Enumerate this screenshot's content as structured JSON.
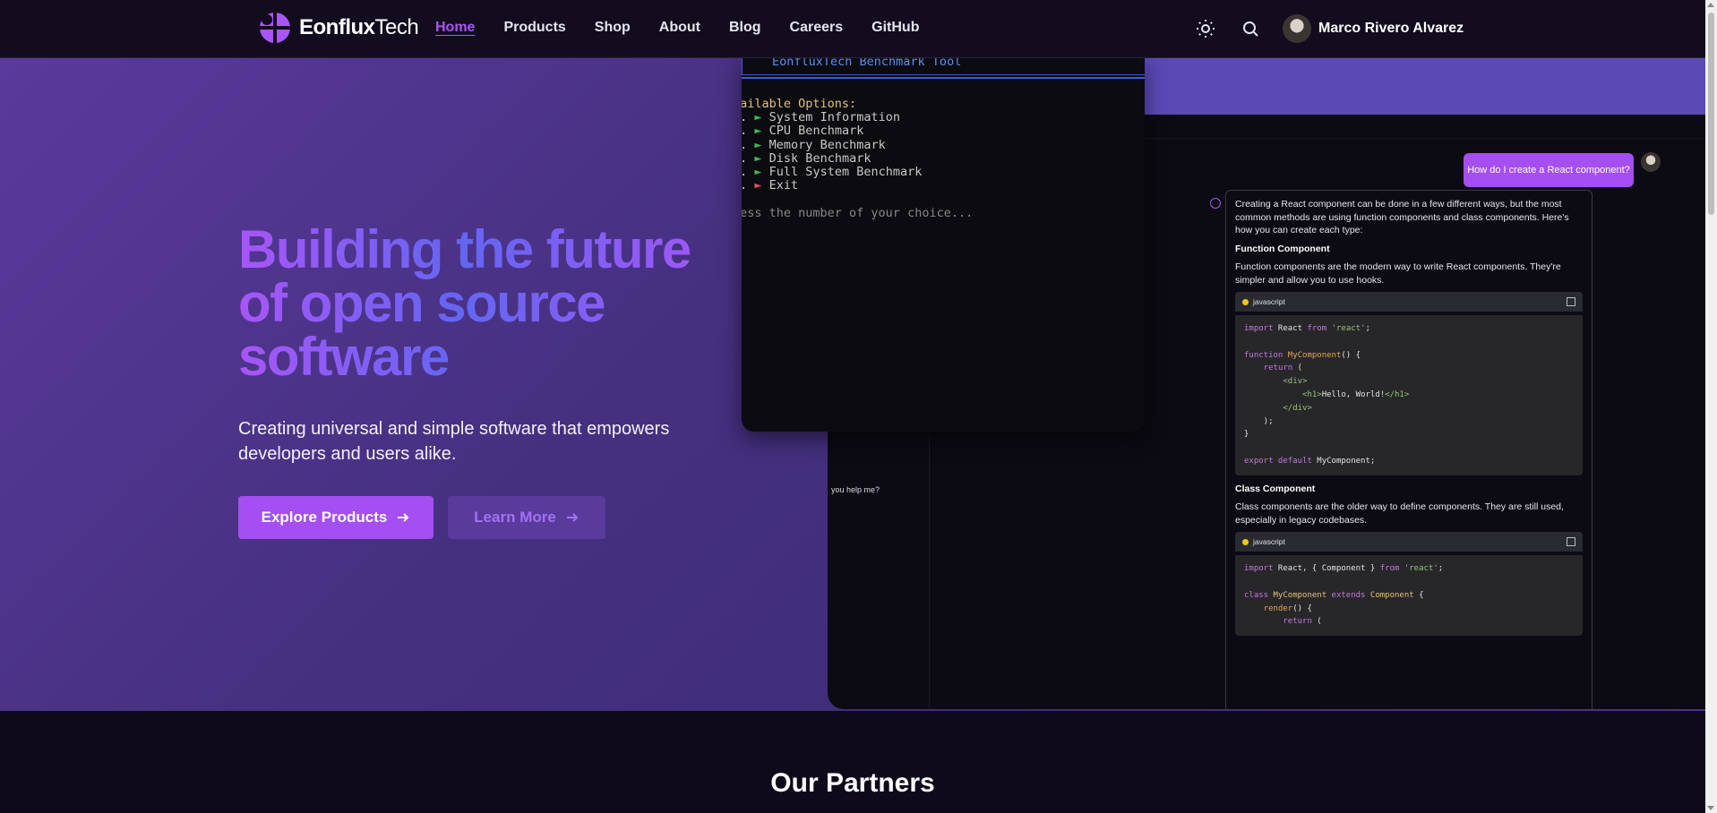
{
  "nav": {
    "brand_bold": "Eonflux",
    "brand_light": "Tech",
    "links": [
      "Home",
      "Products",
      "Shop",
      "About",
      "Blog",
      "Careers",
      "GitHub"
    ],
    "active_link": "Home",
    "user_name": "Marco Rivero Alvarez",
    "icons": [
      "theme-toggle-icon",
      "search-icon"
    ]
  },
  "hero": {
    "title": "Building the future of open source software",
    "subtitle": "Creating universal and simple software that empowers developers and users alike.",
    "primary_button": "Explore Products",
    "secondary_button": "Learn More"
  },
  "terminal": {
    "title": "EonfluxTech Benchmark Tool",
    "options_header": "vailable Options:",
    "options": [
      "System Information",
      "CPU Benchmark",
      "Memory Benchmark",
      "Disk Benchmark",
      "Full System Benchmark",
      "Exit"
    ],
    "prompt": "ress the number of your choice..."
  },
  "chat": {
    "user_message": "How do I create a React component?",
    "fragment_text": "you help me?",
    "intro": "Creating a React component can be done in a few different ways, but the most common methods are using function components and class components. Here's how you can create each type:",
    "function_heading": "Function Component",
    "function_desc": "Function components are the modern way to write React components. They're simpler and allow you to use hooks.",
    "class_heading": "Class Component",
    "class_desc": "Class components are the older way to define components. They are still used, especially in legacy codebases.",
    "code_language": "javascript"
  },
  "partners": {
    "title": "Our Partners"
  },
  "colors": {
    "accent": "#a855f7",
    "indigo": "#6366f1",
    "nav_bg": "#130c1f",
    "hero_bg": "#45307f"
  }
}
